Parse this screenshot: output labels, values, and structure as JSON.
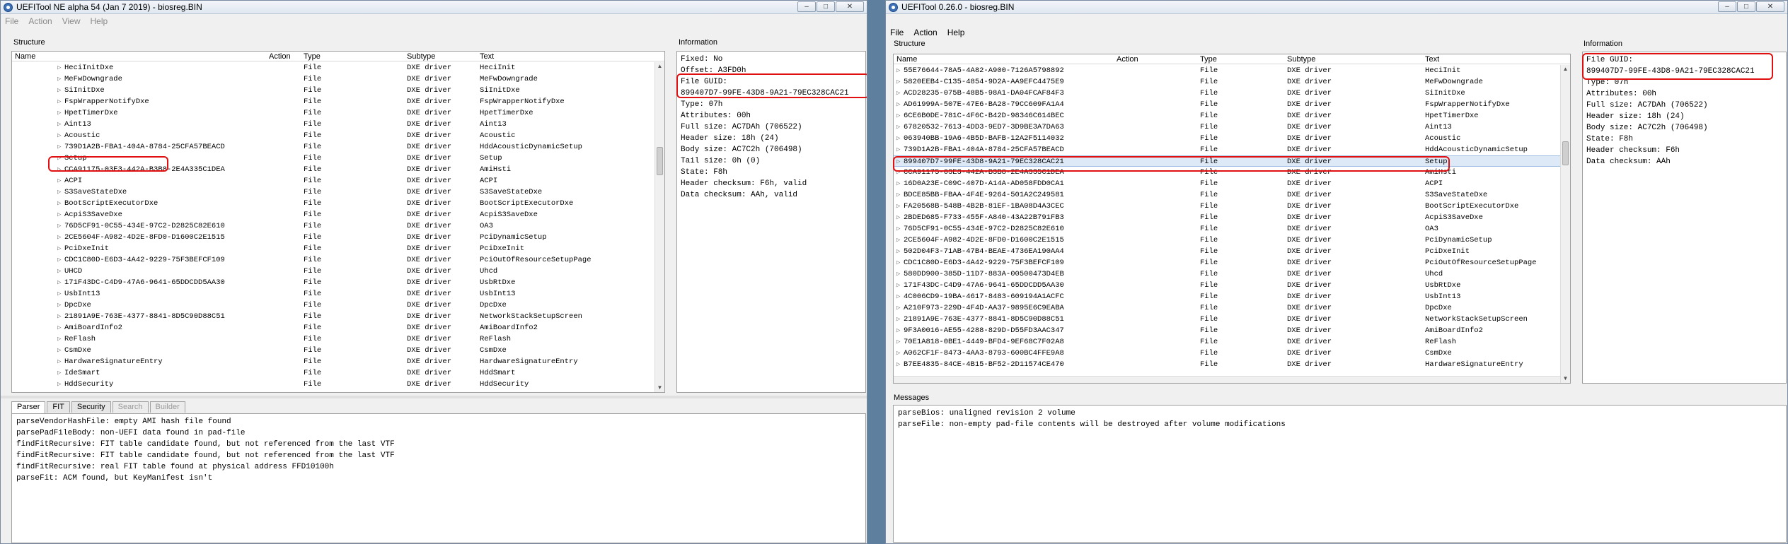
{
  "colors": {
    "highlight": "#e01010",
    "selection": "#dde9f7"
  },
  "left": {
    "title": "UEFITool NE alpha 54 (Jan  7 2019) - biosreg.BIN",
    "menu": [
      "File",
      "Action",
      "View",
      "Help"
    ],
    "structure_label": "Structure",
    "columns": [
      "Name",
      "Action",
      "Type",
      "Subtype",
      "Text"
    ],
    "rows": [
      {
        "name": "HeciInitDxe",
        "type": "File",
        "subtype": "DXE driver",
        "text": "HeciInit"
      },
      {
        "name": "MeFwDowngrade",
        "type": "File",
        "subtype": "DXE driver",
        "text": "MeFwDowngrade"
      },
      {
        "name": "SiInitDxe",
        "type": "File",
        "subtype": "DXE driver",
        "text": "SiInitDxe"
      },
      {
        "name": "FspWrapperNotifyDxe",
        "type": "File",
        "subtype": "DXE driver",
        "text": "FspWrapperNotifyDxe"
      },
      {
        "name": "HpetTimerDxe",
        "type": "File",
        "subtype": "DXE driver",
        "text": "HpetTimerDxe"
      },
      {
        "name": "Aint13",
        "type": "File",
        "subtype": "DXE driver",
        "text": "Aint13"
      },
      {
        "name": "Acoustic",
        "type": "File",
        "subtype": "DXE driver",
        "text": "Acoustic"
      },
      {
        "name": "739D1A2B-FBA1-404A-8784-25CFA57BEACD",
        "type": "File",
        "subtype": "DXE driver",
        "text": "HddAcousticDynamicSetup"
      },
      {
        "name": "Setup",
        "type": "File",
        "subtype": "DXE driver",
        "text": "Setup"
      },
      {
        "name": "CCA91175-03E3-442A-B3B8-2E4A335C1DEA",
        "type": "File",
        "subtype": "DXE driver",
        "text": "AmiHsti"
      },
      {
        "name": "ACPI",
        "type": "File",
        "subtype": "DXE driver",
        "text": "ACPI"
      },
      {
        "name": "S3SaveStateDxe",
        "type": "File",
        "subtype": "DXE driver",
        "text": "S3SaveStateDxe"
      },
      {
        "name": "BootScriptExecutorDxe",
        "type": "File",
        "subtype": "DXE driver",
        "text": "BootScriptExecutorDxe"
      },
      {
        "name": "AcpiS3SaveDxe",
        "type": "File",
        "subtype": "DXE driver",
        "text": "AcpiS3SaveDxe"
      },
      {
        "name": "76D5CF91-0C55-434E-97C2-D2825C82E610",
        "type": "File",
        "subtype": "DXE driver",
        "text": "OA3"
      },
      {
        "name": "2CE5604F-A982-4D2E-8FD0-D1600C2E1515",
        "type": "File",
        "subtype": "DXE driver",
        "text": "PciDynamicSetup"
      },
      {
        "name": "PciDxeInit",
        "type": "File",
        "subtype": "DXE driver",
        "text": "PciDxeInit"
      },
      {
        "name": "CDC1C80D-E6D3-4A42-9229-75F3BEFCF109",
        "type": "File",
        "subtype": "DXE driver",
        "text": "PciOutOfResourceSetupPage"
      },
      {
        "name": "UHCD",
        "type": "File",
        "subtype": "DXE driver",
        "text": "Uhcd"
      },
      {
        "name": "171F43DC-C4D9-47A6-9641-65DDCDD5AA30",
        "type": "File",
        "subtype": "DXE driver",
        "text": "UsbRtDxe"
      },
      {
        "name": "UsbInt13",
        "type": "File",
        "subtype": "DXE driver",
        "text": "UsbInt13"
      },
      {
        "name": "DpcDxe",
        "type": "File",
        "subtype": "DXE driver",
        "text": "DpcDxe"
      },
      {
        "name": "21891A9E-763E-4377-8841-8D5C90D88C51",
        "type": "File",
        "subtype": "DXE driver",
        "text": "NetworkStackSetupScreen"
      },
      {
        "name": "AmiBoardInfo2",
        "type": "File",
        "subtype": "DXE driver",
        "text": "AmiBoardInfo2"
      },
      {
        "name": "ReFlash",
        "type": "File",
        "subtype": "DXE driver",
        "text": "ReFlash"
      },
      {
        "name": "CsmDxe",
        "type": "File",
        "subtype": "DXE driver",
        "text": "CsmDxe"
      },
      {
        "name": "HardwareSignatureEntry",
        "type": "File",
        "subtype": "DXE driver",
        "text": "HardwareSignatureEntry"
      },
      {
        "name": "IdeSmart",
        "type": "File",
        "subtype": "DXE driver",
        "text": "HddSmart"
      },
      {
        "name": "HddSecurity",
        "type": "File",
        "subtype": "DXE driver",
        "text": "HddSecurity"
      }
    ],
    "info_label": "Information",
    "info_lines": [
      "Fixed: No",
      "Offset: A3FD0h",
      "File GUID:",
      "899407D7-99FE-43D8-9A21-79EC328CAC21",
      "Type: 07h",
      "Attributes: 00h",
      "Full size: AC7DAh (706522)",
      "Header size: 18h (24)",
      "Body size: AC7C2h (706498)",
      "Tail size: 0h (0)",
      "State: F8h",
      "Header checksum: F6h, valid",
      "Data checksum: AAh, valid"
    ],
    "tabs": [
      "Parser",
      "FIT",
      "Security",
      "Search",
      "Builder"
    ],
    "messages": [
      "parseVendorHashFile: empty AMI hash file found",
      "parsePadFileBody: non-UEFI data found in pad-file",
      "findFitRecursive: FIT table candidate found, but not referenced from the last VTF",
      "findFitRecursive: FIT table candidate found, but not referenced from the last VTF",
      "findFitRecursive: real FIT table found at physical address FFD10100h",
      "parseFit: ACM found, but KeyManifest isn't"
    ]
  },
  "right": {
    "title": "UEFITool 0.26.0 - biosreg.BIN",
    "menu": [
      "File",
      "Action",
      "Help"
    ],
    "structure_label": "Structure",
    "columns": [
      "Name",
      "Action",
      "Type",
      "Subtype",
      "Text"
    ],
    "rows": [
      {
        "name": "55E76644-78A5-4A82-A900-7126A5798892",
        "type": "File",
        "subtype": "DXE driver",
        "text": "HeciInit"
      },
      {
        "name": "5820EEB4-C135-4854-9D2A-AA9EFC4475E9",
        "type": "File",
        "subtype": "DXE driver",
        "text": "MeFwDowngrade"
      },
      {
        "name": "ACD28235-075B-48B5-98A1-DA04FCAF84F3",
        "type": "File",
        "subtype": "DXE driver",
        "text": "SiInitDxe"
      },
      {
        "name": "AD61999A-507E-47E6-BA28-79CC609FA1A4",
        "type": "File",
        "subtype": "DXE driver",
        "text": "FspWrapperNotifyDxe"
      },
      {
        "name": "6CE6B0DE-781C-4F6C-B42D-98346C614BEC",
        "type": "File",
        "subtype": "DXE driver",
        "text": "HpetTimerDxe"
      },
      {
        "name": "67820532-7613-4DD3-9ED7-3D9BE3A7DA63",
        "type": "File",
        "subtype": "DXE driver",
        "text": "Aint13"
      },
      {
        "name": "063940BB-19A6-4B5D-BAFB-12A2F5114032",
        "type": "File",
        "subtype": "DXE driver",
        "text": "Acoustic"
      },
      {
        "name": "739D1A2B-FBA1-404A-8784-25CFA57BEACD",
        "type": "File",
        "subtype": "DXE driver",
        "text": "HddAcousticDynamicSetup"
      },
      {
        "name": "899407D7-99FE-43D8-9A21-79EC328CAC21",
        "type": "File",
        "subtype": "DXE driver",
        "text": "Setup"
      },
      {
        "name": "CCA91175-03E3-442A-B3B8-2E4A335C1DEA",
        "type": "File",
        "subtype": "DXE driver",
        "text": "AmiHsti"
      },
      {
        "name": "16D0A23E-C09C-407D-A14A-AD058FDD0CA1",
        "type": "File",
        "subtype": "DXE driver",
        "text": "ACPI"
      },
      {
        "name": "BDCE85BB-FBAA-4F4E-9264-501A2C249581",
        "type": "File",
        "subtype": "DXE driver",
        "text": "S3SaveStateDxe"
      },
      {
        "name": "FA20568B-548B-4B2B-81EF-1BA08D4A3CEC",
        "type": "File",
        "subtype": "DXE driver",
        "text": "BootScriptExecutorDxe"
      },
      {
        "name": "2BDED685-F733-455F-A840-43A22B791FB3",
        "type": "File",
        "subtype": "DXE driver",
        "text": "AcpiS3SaveDxe"
      },
      {
        "name": "76D5CF91-0C55-434E-97C2-D2825C82E610",
        "type": "File",
        "subtype": "DXE driver",
        "text": "OA3"
      },
      {
        "name": "2CE5604F-A982-4D2E-8FD0-D1600C2E1515",
        "type": "File",
        "subtype": "DXE driver",
        "text": "PciDynamicSetup"
      },
      {
        "name": "502D04F3-71AB-47B4-BEAE-4736EA190AA4",
        "type": "File",
        "subtype": "DXE driver",
        "text": "PciDxeInit"
      },
      {
        "name": "CDC1C80D-E6D3-4A42-9229-75F3BEFCF109",
        "type": "File",
        "subtype": "DXE driver",
        "text": "PciOutOfResourceSetupPage"
      },
      {
        "name": "580DD900-385D-11D7-883A-00500473D4EB",
        "type": "File",
        "subtype": "DXE driver",
        "text": "Uhcd"
      },
      {
        "name": "171F43DC-C4D9-47A6-9641-65DDCDD5AA30",
        "type": "File",
        "subtype": "DXE driver",
        "text": "UsbRtDxe"
      },
      {
        "name": "4C006CD9-19BA-4617-8483-609194A1ACFC",
        "type": "File",
        "subtype": "DXE driver",
        "text": "UsbInt13"
      },
      {
        "name": "A210F973-229D-4F4D-AA37-9895E6C9EABA",
        "type": "File",
        "subtype": "DXE driver",
        "text": "DpcDxe"
      },
      {
        "name": "21891A9E-763E-4377-8841-8D5C90D88C51",
        "type": "File",
        "subtype": "DXE driver",
        "text": "NetworkStackSetupScreen"
      },
      {
        "name": "9F3A0016-AE55-4288-829D-D55FD3AAC347",
        "type": "File",
        "subtype": "DXE driver",
        "text": "AmiBoardInfo2"
      },
      {
        "name": "70E1A818-0BE1-4449-BFD4-9EF68C7F02A8",
        "type": "File",
        "subtype": "DXE driver",
        "text": "ReFlash"
      },
      {
        "name": "A062CF1F-8473-4AA3-8793-600BC4FFE9A8",
        "type": "File",
        "subtype": "DXE driver",
        "text": "CsmDxe"
      },
      {
        "name": "B7EE4835-84CE-4B15-BF52-2D11574CE470",
        "type": "File",
        "subtype": "DXE driver",
        "text": "HardwareSignatureEntry"
      }
    ],
    "info_label": "Information",
    "info_lines": [
      "File GUID:",
      "899407D7-99FE-43D8-9A21-79EC328CAC21",
      "Type: 07h",
      "Attributes: 00h",
      "Full size: AC7DAh (706522)",
      "Header size: 18h (24)",
      "Body size: AC7C2h (706498)",
      "State: F8h",
      "Header checksum: F6h",
      "Data checksum: AAh"
    ],
    "messages_label": "Messages",
    "messages": [
      "parseBios: unaligned revision 2 volume",
      "parseFile: non-empty pad-file contents will be destroyed after volume modifications"
    ]
  }
}
